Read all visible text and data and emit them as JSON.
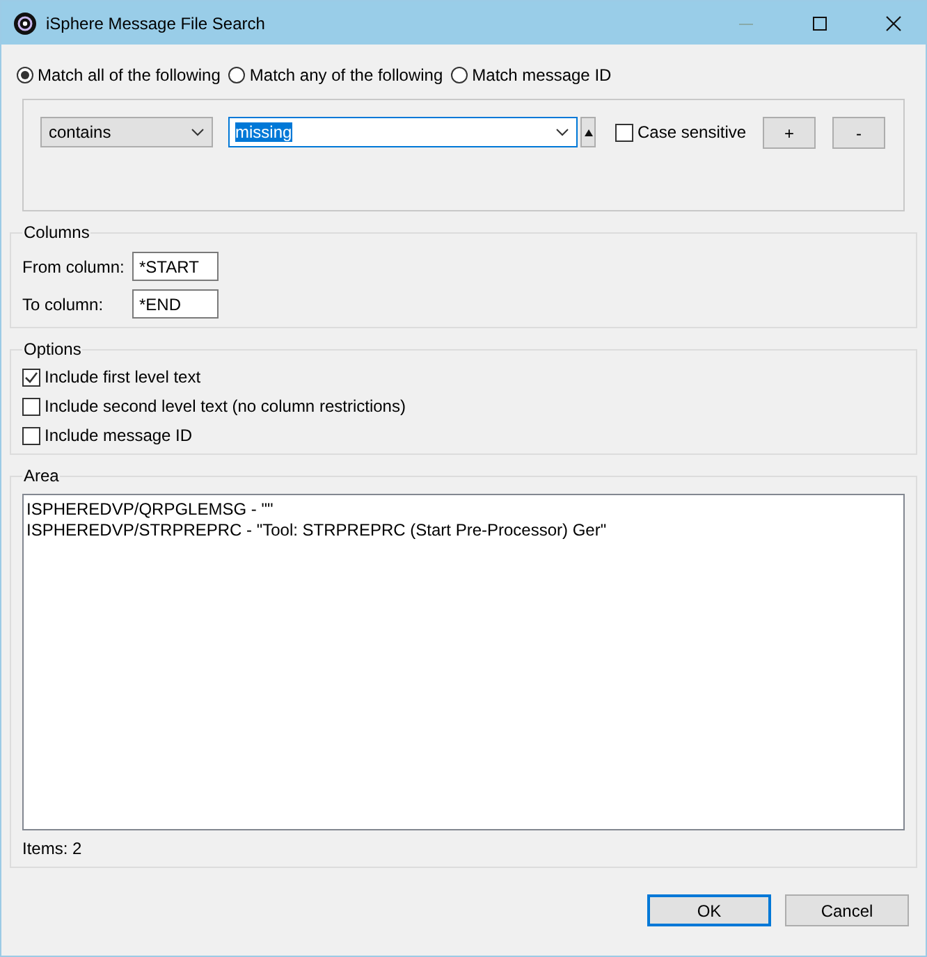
{
  "window": {
    "title": "iSphere Message File Search"
  },
  "match_modes": [
    {
      "label": "Match all of the following",
      "selected": true
    },
    {
      "label": "Match any of the following",
      "selected": false
    },
    {
      "label": "Match message ID",
      "selected": false
    }
  ],
  "criterion": {
    "operator": "contains",
    "value": "missing",
    "value_selected": true,
    "case_sensitive": {
      "label": "Case sensitive",
      "checked": false
    },
    "add_button": "+",
    "remove_button": "-"
  },
  "columns": {
    "title": "Columns",
    "fields": [
      {
        "label": "From column:",
        "value": "*START"
      },
      {
        "label": "To column:",
        "value": "*END"
      }
    ]
  },
  "options": {
    "title": "Options",
    "items": [
      {
        "label": "Include first level text",
        "checked": true
      },
      {
        "label": "Include second level text (no column restrictions)",
        "checked": false
      },
      {
        "label": "Include message ID",
        "checked": false
      }
    ]
  },
  "area": {
    "title": "Area",
    "items": [
      "ISPHEREDVP/QRPGLEMSG - \"\"",
      "ISPHEREDVP/STRPREPRC - \"Tool: STRPREPRC  (Start Pre-Processor) Ger\""
    ],
    "count": "Items: 2"
  },
  "buttons": [
    {
      "label": "OK",
      "default": true
    },
    {
      "label": "Cancel",
      "default": false
    }
  ]
}
